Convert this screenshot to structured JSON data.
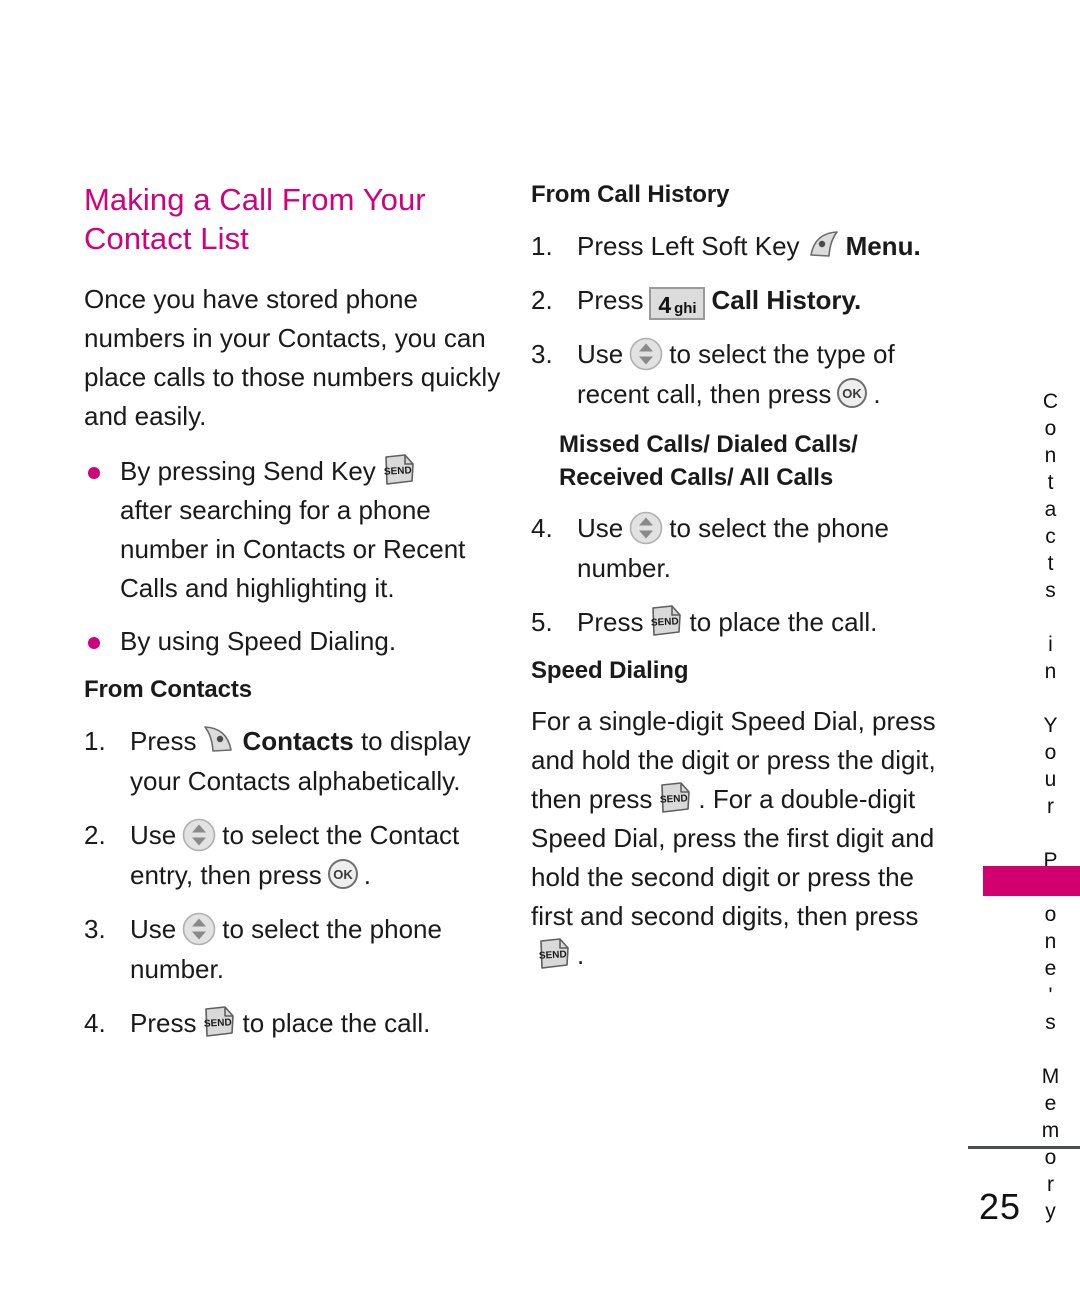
{
  "page": {
    "number": "25",
    "side_tab_label": "Contacts in Your Phone's Memory",
    "accent_color": "#d1007c",
    "tab_color": "#d1006e"
  },
  "left_column": {
    "title": "Making a Call From Your Contact List",
    "intro": "Once you have stored phone numbers in your Contacts, you can place calls to those numbers quickly and easily.",
    "bullets": [
      {
        "pre": "By pressing Send Key",
        "icon": "send-key-icon",
        "post": "after searching for a phone number in Contacts or Recent Calls and highlighting it."
      },
      {
        "pre": "By using Speed Dialing.",
        "icon": "",
        "post": ""
      }
    ],
    "section_heading": "From Contacts",
    "steps": [
      {
        "num": "1.",
        "pre": "Press",
        "icon": "right-soft-key-icon",
        "mid_bold": "Contacts",
        "post": "to display your Contacts alphabetically."
      },
      {
        "num": "2.",
        "pre": "Use",
        "icon": "nav-updown-icon",
        "mid_bold": "",
        "post": "to select the Contact entry, then press",
        "icon2": "ok-key-icon",
        "tail": "."
      },
      {
        "num": "3.",
        "pre": "Use",
        "icon": "nav-updown-icon",
        "mid_bold": "",
        "post": "to select the phone number."
      },
      {
        "num": "4.",
        "pre": "Press",
        "icon": "send-key-icon",
        "mid_bold": "",
        "post": "to place the call."
      }
    ]
  },
  "right_column": {
    "section_heading": "From Call History",
    "steps": [
      {
        "num": "1.",
        "pre": "Press Left Soft Key",
        "icon": "left-soft-key-icon",
        "bold_after": "Menu."
      },
      {
        "num": "2.",
        "pre": "Press",
        "icon": "numeric-key-4-icon",
        "key_digit": "4",
        "key_letters": "ghi",
        "bold_after": "Call History."
      },
      {
        "num": "3.",
        "pre": "Use",
        "icon": "nav-updown-icon",
        "post": "to select the type of recent call, then press",
        "icon2": "ok-key-icon",
        "tail": "."
      }
    ],
    "call_types_heading": "Missed Calls/ Dialed Calls/ Received Calls/ All Calls",
    "steps2": [
      {
        "num": "4.",
        "pre": "Use",
        "icon": "nav-updown-icon",
        "post": "to select the phone number."
      },
      {
        "num": "5.",
        "pre": "Press",
        "icon": "send-key-icon",
        "post": "to place the call."
      }
    ],
    "speed_dialing_heading": "Speed Dialing",
    "speed_dialing_part1": "For a single-digit Speed Dial, press and hold the digit or press the digit, then press",
    "speed_dialing_part2": ". For a double-digit Speed Dial, press the first digit and hold the second digit or press the first and second digits, then press",
    "speed_dialing_part3": "."
  },
  "icons": {
    "send_label": "SEND",
    "ok_label": "OK"
  }
}
